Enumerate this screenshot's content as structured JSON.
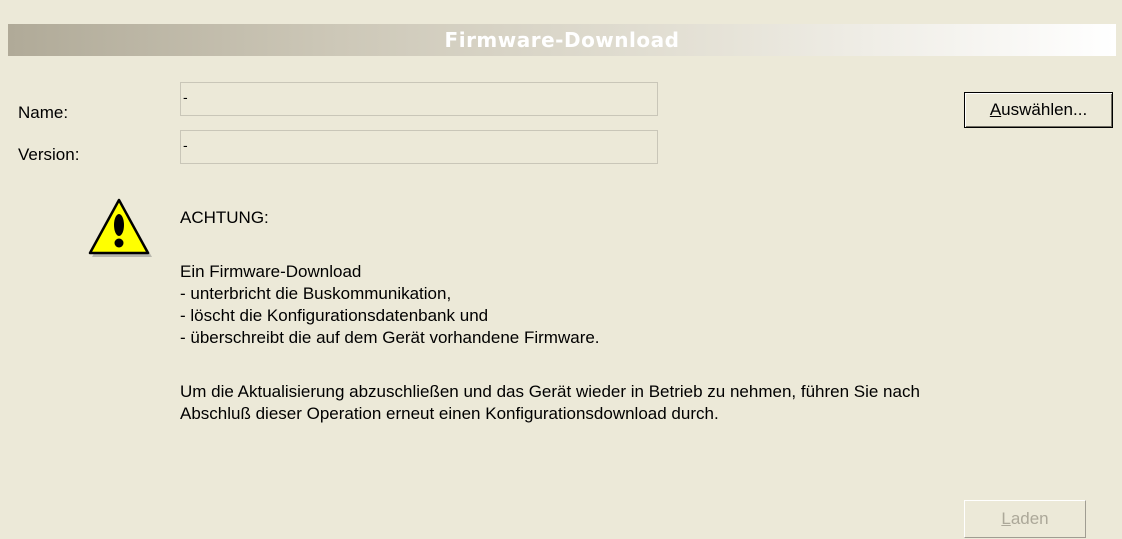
{
  "title": "Firmware-Download",
  "form": {
    "name_label": "Name:",
    "name_value": "-",
    "version_label": "Version:",
    "version_value": "-"
  },
  "buttons": {
    "select_label": "Auswählen...",
    "load_label": "Laden"
  },
  "warning": {
    "icon": "warning-triangle-icon",
    "heading": "ACHTUNG:",
    "intro": "Ein Firmware-Download",
    "items": [
      "- unterbricht die Buskommunikation,",
      "- löscht die Konfigurationsdatenbank und",
      "- überschreibt die auf dem Gerät vorhandene Firmware."
    ],
    "note_line1": "Um die Aktualisierung abzuschließen und das Gerät wieder in Betrieb zu nehmen, führen Sie nach",
    "note_line2": "Abschluß dieser Operation erneut einen Konfigurationsdownload durch."
  }
}
